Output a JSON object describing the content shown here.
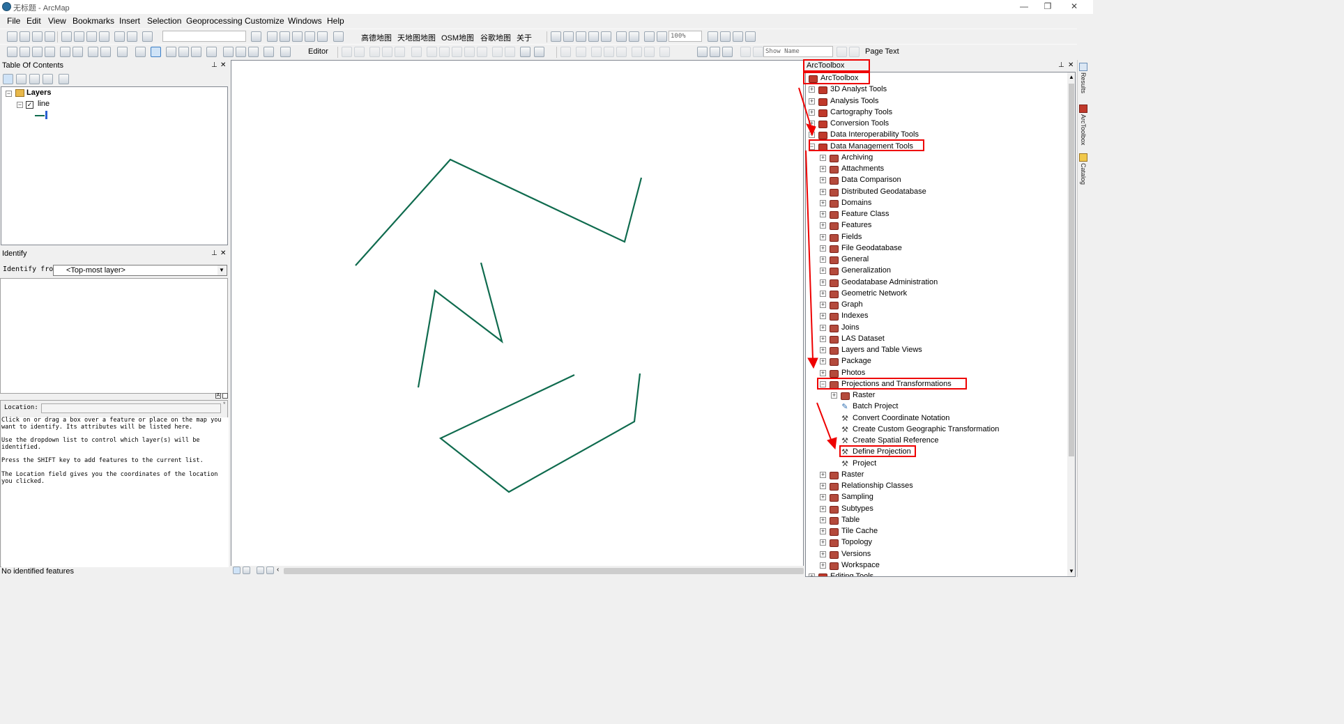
{
  "window": {
    "title": "无标题 - ArcMap",
    "controls": [
      "—",
      "❐",
      "✕"
    ]
  },
  "menu": [
    "File",
    "Edit",
    "View",
    "Bookmarks",
    "Insert",
    "Selection",
    "Geoprocessing",
    "Customize",
    "Windows",
    "Help"
  ],
  "toolbar": {
    "maps": [
      "高德地图",
      "天地图地图",
      "OSM地图",
      "谷歌地图",
      "关于"
    ],
    "zoom_value": "100%",
    "editor_label": "Editor",
    "show_name": "Show Name",
    "page_text": "Page Text"
  },
  "toc": {
    "title": "Table Of Contents",
    "layers_label": "Layers",
    "layer_name": "line"
  },
  "identify": {
    "title": "Identify",
    "from_label": "Identify from:",
    "from_value": "<Top-most layer>",
    "location_label": "Location:",
    "help": [
      "Click on or drag a box over a feature or place on the map you want to identify. Its attributes will be listed here.",
      "Use the dropdown list to control which layer(s) will be identified.",
      "Press the SHIFT key to add features to the current list.",
      "The Location field gives you the coordinates of the location you clicked."
    ]
  },
  "status": {
    "text": "No identified features"
  },
  "arctoolbox": {
    "title": "ArcToolbox",
    "root": "ArcToolbox",
    "top_items": [
      "3D Analyst Tools",
      "Analysis Tools",
      "Cartography Tools",
      "Conversion Tools",
      "Data Interoperability Tools"
    ],
    "dm_label": "Data Management Tools",
    "dm_children": [
      "Archiving",
      "Attachments",
      "Data Comparison",
      "Distributed Geodatabase",
      "Domains",
      "Feature Class",
      "Features",
      "Fields",
      "File Geodatabase",
      "General",
      "Generalization",
      "Geodatabase Administration",
      "Geometric Network",
      "Graph",
      "Indexes",
      "Joins",
      "LAS Dataset",
      "Layers and Table Views",
      "Package",
      "Photos"
    ],
    "proj_label": "Projections and Transformations",
    "proj_raster": "Raster",
    "proj_tools": [
      "Batch Project",
      "Convert Coordinate Notation",
      "Create Custom Geographic Transformation",
      "Create Spatial Reference",
      "Define Projection",
      "Project"
    ],
    "after_children": [
      "Raster",
      "Relationship Classes",
      "Sampling",
      "Subtypes",
      "Table",
      "Tile Cache",
      "Topology",
      "Versions",
      "Workspace"
    ],
    "tail_item": "Editing Tools"
  },
  "side_tabs": [
    "Results",
    "ArcToolbox",
    "Catalog"
  ],
  "colors": {
    "line": "#0f6b4e",
    "highlight": "#e00000"
  }
}
